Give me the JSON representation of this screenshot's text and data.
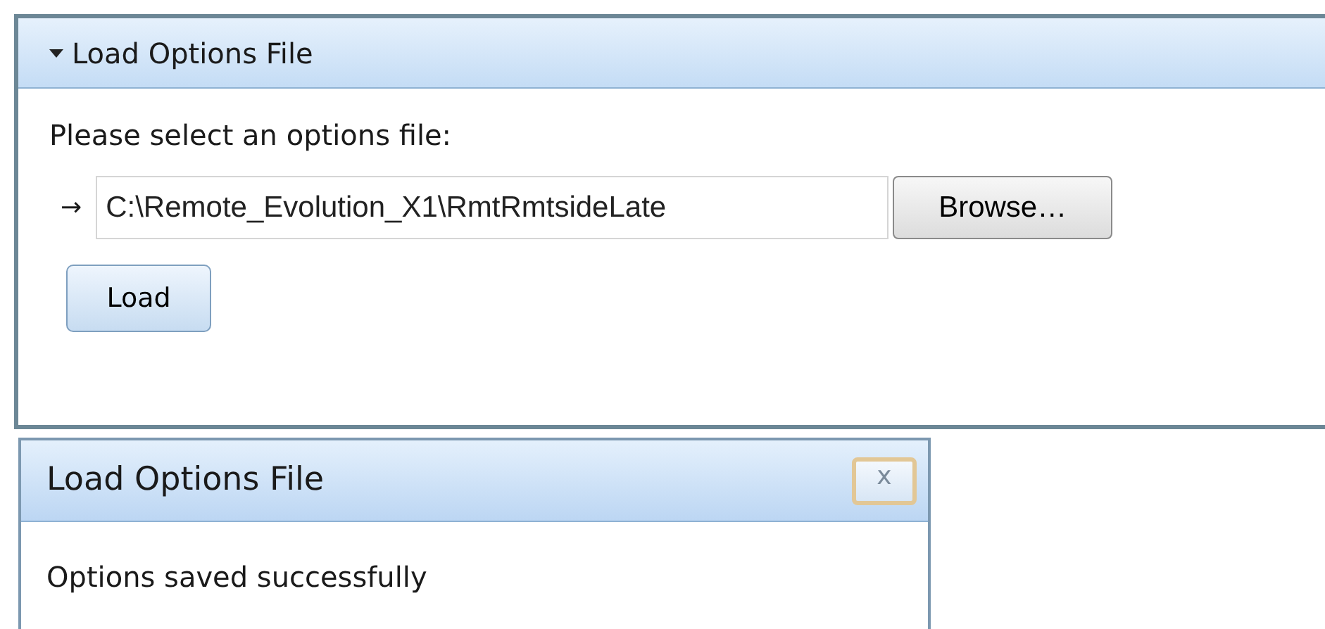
{
  "panel": {
    "title": "Load Options File",
    "expanded": true,
    "prompt": "Please select an options file:",
    "arrow": "→",
    "file_path": "C:\\Remote_Evolution_X1\\RmtRmtsideLate",
    "browse_button": "Browse…",
    "load_button": "Load"
  },
  "dialog": {
    "title": "Load Options File",
    "close": "x",
    "message": "Options saved successfully"
  }
}
